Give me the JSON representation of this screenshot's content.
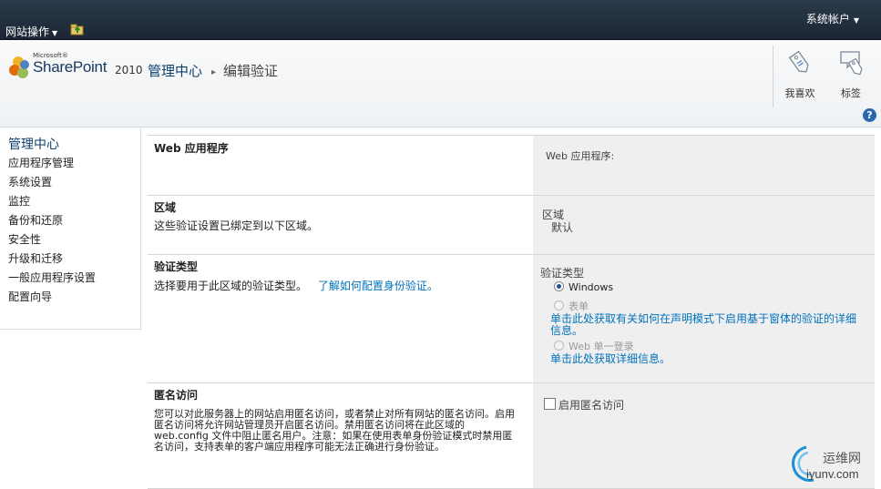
{
  "topbar": {
    "site_actions": "网站操作",
    "account": "系统帐户"
  },
  "brand": {
    "ms": "Microsoft®",
    "product": "SharePoint",
    "year": "2010"
  },
  "breadcrumb": {
    "root": "管理中心",
    "separator": "▸",
    "current": "编辑验证"
  },
  "actions": {
    "like": "我喜欢",
    "tags": "标签"
  },
  "help": {
    "label": "?"
  },
  "leftnav": {
    "heading": "管理中心",
    "items": [
      "应用程序管理",
      "系统设置",
      "监控",
      "备份和还原",
      "安全性",
      "升级和迁移",
      "一般应用程序设置",
      "配置向导"
    ]
  },
  "sections": {
    "webapp": {
      "title": "Web 应用程序",
      "right_label": "Web 应用程序:"
    },
    "zone": {
      "title": "区域",
      "desc": "这些验证设置已绑定到以下区域。",
      "right_label": "区域",
      "right_value": "默认"
    },
    "authtype": {
      "title": "验证类型",
      "desc": "选择要用于此区域的验证类型。",
      "desc_link": "了解如何配置身份验证。",
      "right_label": "验证类型",
      "options": [
        "Windows",
        "表单",
        "Web 单一登录"
      ],
      "selected": "Windows",
      "form_info": "单击此处获取有关如何在声明模式下启用基于窗体的验证的详细信息。",
      "sso_info": "单击此处获取详细信息。"
    },
    "anon": {
      "title": "匿名访问",
      "desc": "您可以对此服务器上的网站启用匿名访问，或者禁止对所有网站的匿名访问。启用匿名访问将允许网站管理员开启匿名访问。禁用匿名访问将在此区域的 web.config 文件中阻止匿名用户。注意：如果在使用表单身份验证模式时禁用匿名访问，支持表单的客户端应用程序可能无法正确进行身份验证。",
      "checkbox_label": "启用匿名访问",
      "checked": false
    }
  },
  "watermark": {
    "cn": "运维网",
    "url": "iyunv.com"
  }
}
